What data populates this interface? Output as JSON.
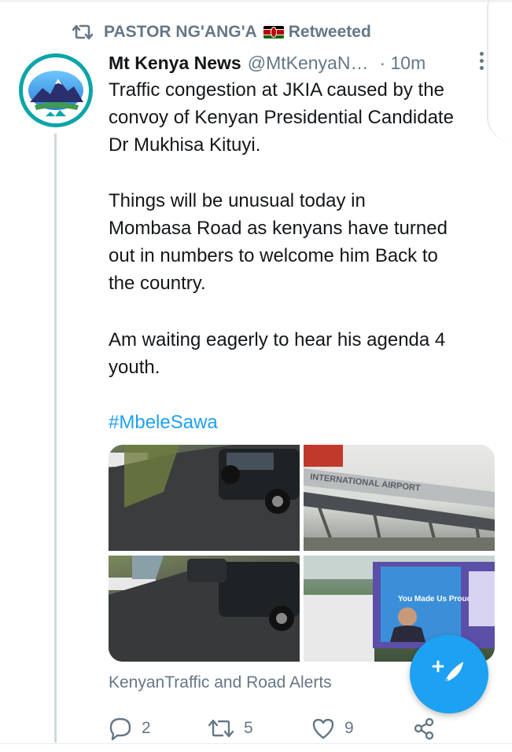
{
  "retweet": {
    "icon": "retweet-icon",
    "user": "PASTOR NG'ANG'A",
    "flag": "kenya-flag",
    "label": "Retweeted"
  },
  "tweet": {
    "avatar_alt": "Mt Kenya News",
    "name": "Mt Kenya News",
    "handle": "@MtKenyaN…",
    "time": "· 10m",
    "paragraphs": [
      "Traffic congestion at JKIA caused by the\nconvoy of Kenyan Presidential Candidate\nDr Mukhisa Kituyi.",
      "Things will be unusual today in\nMombasa Road as kenyans have turned\nout in numbers to welcome him Back to\nthe country.",
      "Am waiting eagerly to hear his agenda 4\nyouth."
    ],
    "hashtag": "#MbeleSawa",
    "photos": [
      {
        "name": "photo-road-convoy-1",
        "kind": "image"
      },
      {
        "name": "photo-international-airport",
        "kind": "image",
        "text": "INTERNATIONAL AIRPORT"
      },
      {
        "name": "photo-road-convoy-2",
        "kind": "image"
      },
      {
        "name": "photo-campaign-bus",
        "kind": "image",
        "text": "You Made Us Proud"
      }
    ],
    "card_source": "KenyanTraffic and Road Alerts",
    "actions": {
      "reply_count": "2",
      "retweet_count": "5",
      "like_count": "9"
    }
  },
  "colors": {
    "accent": "#1da1f2",
    "muted": "#657786",
    "text": "#14171a"
  }
}
